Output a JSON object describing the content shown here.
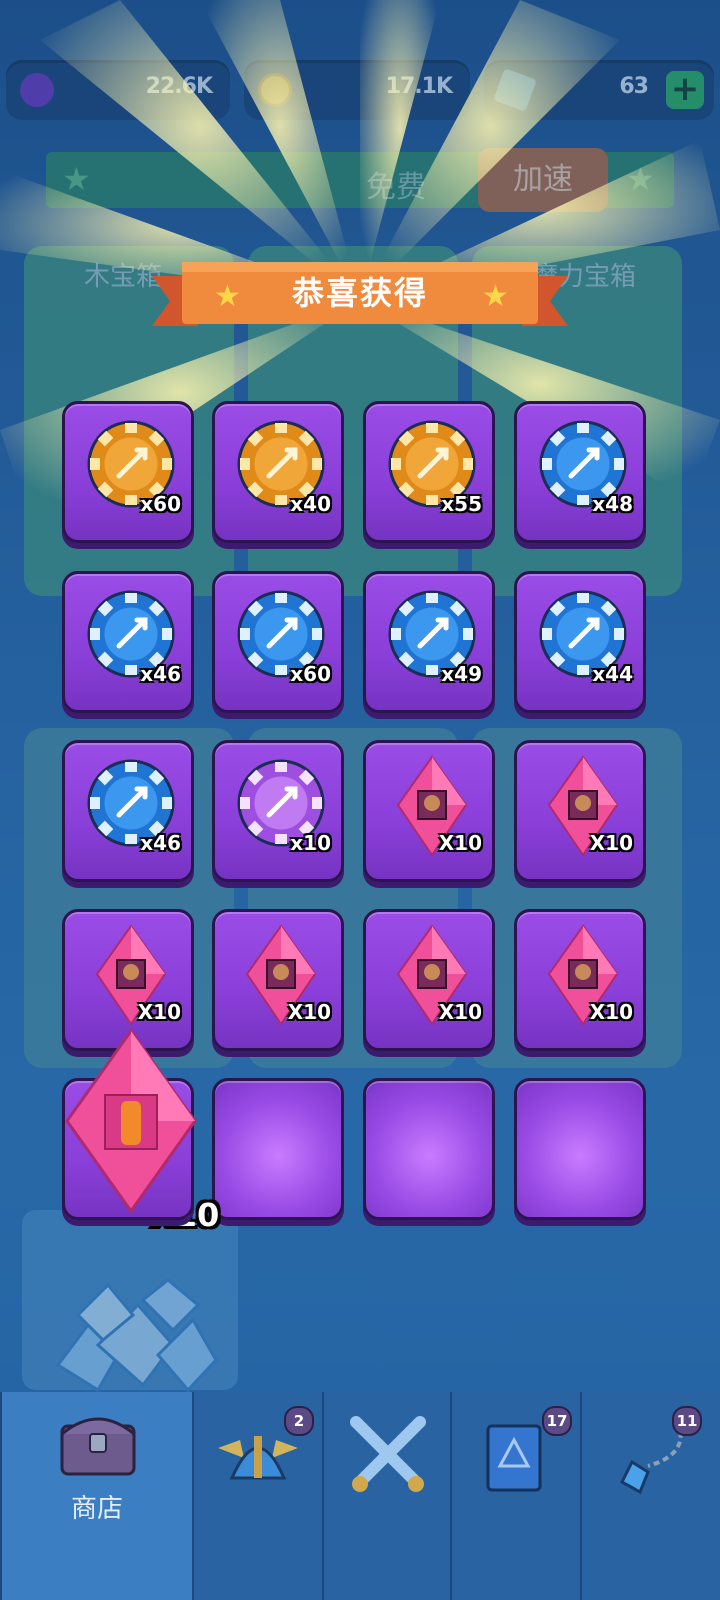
{
  "currencies": [
    {
      "name": "purple-orb",
      "value": "22.6K",
      "color": "#7a3fd0"
    },
    {
      "name": "gold-coin",
      "value": "17.1K",
      "color": "#d7a823"
    },
    {
      "name": "blue-gem",
      "value": "63",
      "color": "#3c8ee6"
    }
  ],
  "shop": {
    "free_label": "免费",
    "speed_label": "加速",
    "chest_names": [
      "木宝箱",
      "",
      "魔力宝箱"
    ]
  },
  "popup": {
    "title": "恭喜获得",
    "rewards": [
      {
        "icon": "elf-hero-chip-icon",
        "tier": "gold",
        "qty": "x60"
      },
      {
        "icon": "cyclops-hero-chip-icon",
        "tier": "gold",
        "qty": "x40"
      },
      {
        "icon": "winged-emblem-chip-icon",
        "tier": "gold",
        "qty": "x55"
      },
      {
        "icon": "sword-chip-icon",
        "tier": "blue",
        "qty": "x48"
      },
      {
        "icon": "hammer-chip-icon",
        "tier": "blue",
        "qty": "x46"
      },
      {
        "icon": "dagger-chip-icon",
        "tier": "blue",
        "qty": "x60"
      },
      {
        "icon": "bow-chip-icon",
        "tier": "blue",
        "qty": "x49"
      },
      {
        "icon": "dragon-chip-icon",
        "tier": "blue",
        "qty": "x44"
      },
      {
        "icon": "spirit-chip-icon",
        "tier": "blue",
        "qty": "x46"
      },
      {
        "icon": "sword-chip-icon",
        "tier": "purple",
        "qty": "x10"
      },
      {
        "icon": "warrior-shard-icon",
        "tier": "shard",
        "qty": "X10"
      },
      {
        "icon": "goblin-shard-icon",
        "tier": "shard",
        "qty": "X10"
      },
      {
        "icon": "demon-shard-icon",
        "tier": "shard",
        "qty": "X10"
      },
      {
        "icon": "beast-shard-icon",
        "tier": "shard",
        "qty": "X10"
      },
      {
        "icon": "santa-shard-icon",
        "tier": "shard",
        "qty": "X10"
      },
      {
        "icon": "robot-shard-icon",
        "tier": "shard",
        "qty": "X10"
      },
      {
        "icon": "flame-shard-icon",
        "tier": "shard-big",
        "qty": "X10"
      }
    ]
  },
  "nav": [
    {
      "icon": "treasure-chest-icon",
      "label": "商店",
      "badge": ""
    },
    {
      "icon": "winged-helmet-icon",
      "label": "",
      "badge": "2"
    },
    {
      "icon": "crossed-swords-icon",
      "label": "",
      "badge": ""
    },
    {
      "icon": "spell-book-icon",
      "label": "",
      "badge": "17"
    },
    {
      "icon": "amulet-icon",
      "label": "",
      "badge": "11"
    }
  ]
}
